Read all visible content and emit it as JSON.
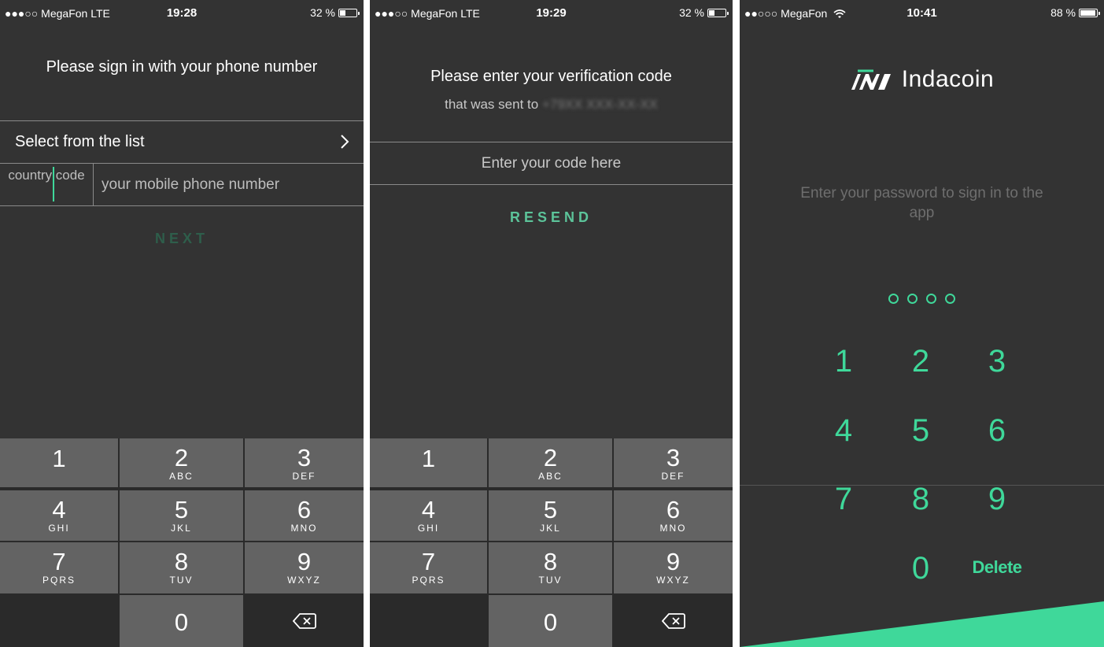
{
  "colors": {
    "background": "#333333",
    "accent": "#3fd89a",
    "key": "#636363"
  },
  "screen1": {
    "status": {
      "carrier": "●●●○○ MegaFon  LTE",
      "time": "19:28",
      "battery": "32 %",
      "battery_level": 0.32
    },
    "title": "Please sign in with your phone number",
    "select_label": "Select from the list",
    "select_icon": "chevron-right-icon",
    "country_code": "country code",
    "phone_placeholder": "your mobile phone number",
    "next": "NEXT"
  },
  "screen2": {
    "status": {
      "carrier": "●●●○○ MegaFon  LTE",
      "time": "19:29",
      "battery": "32 %",
      "battery_level": 0.32
    },
    "title": "Please enter your verification code",
    "subtitle": "that was sent to",
    "phone_masked": "+79XX XXX-XX-XX",
    "code_placeholder": "Enter your code here",
    "resend": "RESEND"
  },
  "keypad": [
    {
      "num": "1",
      "letters": ""
    },
    {
      "num": "2",
      "letters": "ABC"
    },
    {
      "num": "3",
      "letters": "DEF"
    },
    {
      "num": "4",
      "letters": "GHI"
    },
    {
      "num": "5",
      "letters": "JKL"
    },
    {
      "num": "6",
      "letters": "MNO"
    },
    {
      "num": "7",
      "letters": "PQRS"
    },
    {
      "num": "8",
      "letters": "TUV"
    },
    {
      "num": "9",
      "letters": "WXYZ"
    },
    {
      "num": "0",
      "letters": ""
    }
  ],
  "keypad_backspace_icon": "backspace-icon",
  "screen3": {
    "status": {
      "carrier": "●●○○○ MegaFon",
      "time": "10:41",
      "battery": "88 %",
      "battery_level": 0.88
    },
    "brand": "Indacoin",
    "prompt": "Enter your password to sign in to the app",
    "pin_length": 4,
    "pin_keys": [
      "1",
      "2",
      "3",
      "4",
      "5",
      "6",
      "7",
      "8",
      "9",
      "0"
    ],
    "delete": "Delete"
  }
}
